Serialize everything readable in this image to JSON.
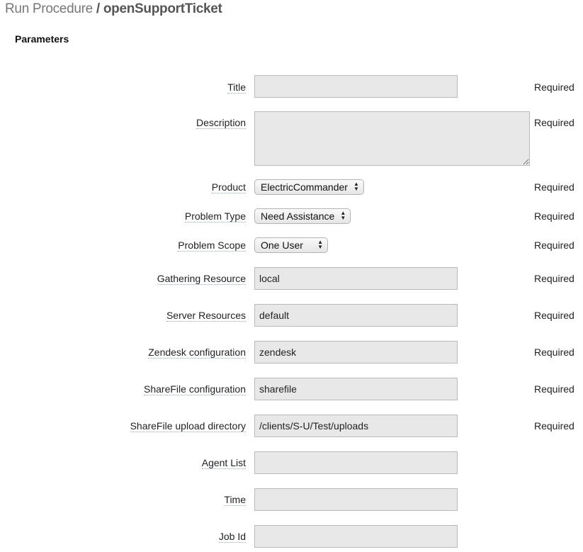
{
  "header": {
    "crumb": "Run Procedure",
    "separator": "/",
    "procedure": "openSupportTicket"
  },
  "section_title": "Parameters",
  "required_text": "Required",
  "fields": {
    "title": {
      "label": "Title",
      "value": ""
    },
    "description": {
      "label": "Description",
      "value": ""
    },
    "product": {
      "label": "Product",
      "selected": "ElectricCommander"
    },
    "problem_type": {
      "label": "Problem Type",
      "selected": "Need Assistance"
    },
    "problem_scope": {
      "label": "Problem Scope",
      "selected": "One User"
    },
    "gathering_resource": {
      "label": "Gathering Resource",
      "value": "local"
    },
    "server_resources": {
      "label": "Server Resources",
      "value": "default"
    },
    "zendesk_configuration": {
      "label": "Zendesk configuration",
      "value": "zendesk"
    },
    "sharefile_configuration": {
      "label": "ShareFile configuration",
      "value": "sharefile"
    },
    "sharefile_upload_directory": {
      "label": "ShareFile upload directory",
      "value": "/clients/S-U/Test/uploads"
    },
    "agent_list": {
      "label": "Agent List",
      "value": ""
    },
    "time": {
      "label": "Time",
      "value": ""
    },
    "job_id": {
      "label": "Job Id",
      "value": ""
    }
  }
}
